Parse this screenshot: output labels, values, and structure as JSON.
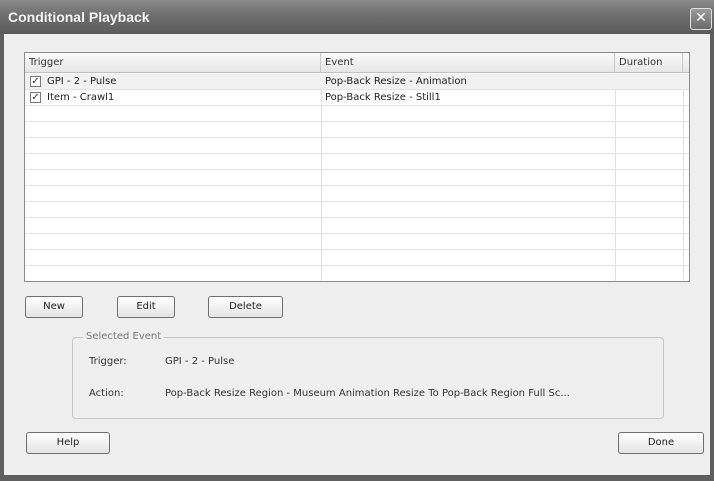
{
  "window": {
    "title": "Conditional Playback",
    "close_glyph": "✕"
  },
  "list": {
    "columns": [
      "Trigger",
      "Event",
      "Duration"
    ],
    "rows": [
      {
        "checked": true,
        "trigger": "GPI - 2 - Pulse",
        "event": "Pop-Back Resize  - Animation",
        "duration": ""
      },
      {
        "checked": true,
        "trigger": "Item - Crawl1",
        "event": "Pop-Back Resize  - Still1",
        "duration": ""
      }
    ],
    "check_glyph": "✓"
  },
  "buttons": {
    "new": "New",
    "edit": "Edit",
    "delete": "Delete",
    "help": "Help",
    "done": "Done"
  },
  "selected_event": {
    "title": "Selected Event",
    "trigger_label": "Trigger:",
    "trigger_value": "GPI - 2 - Pulse",
    "action_label": "Action:",
    "action_value": "Pop-Back Resize Region - Museum Animation Resize To Pop-Back Region Full Sc..."
  }
}
